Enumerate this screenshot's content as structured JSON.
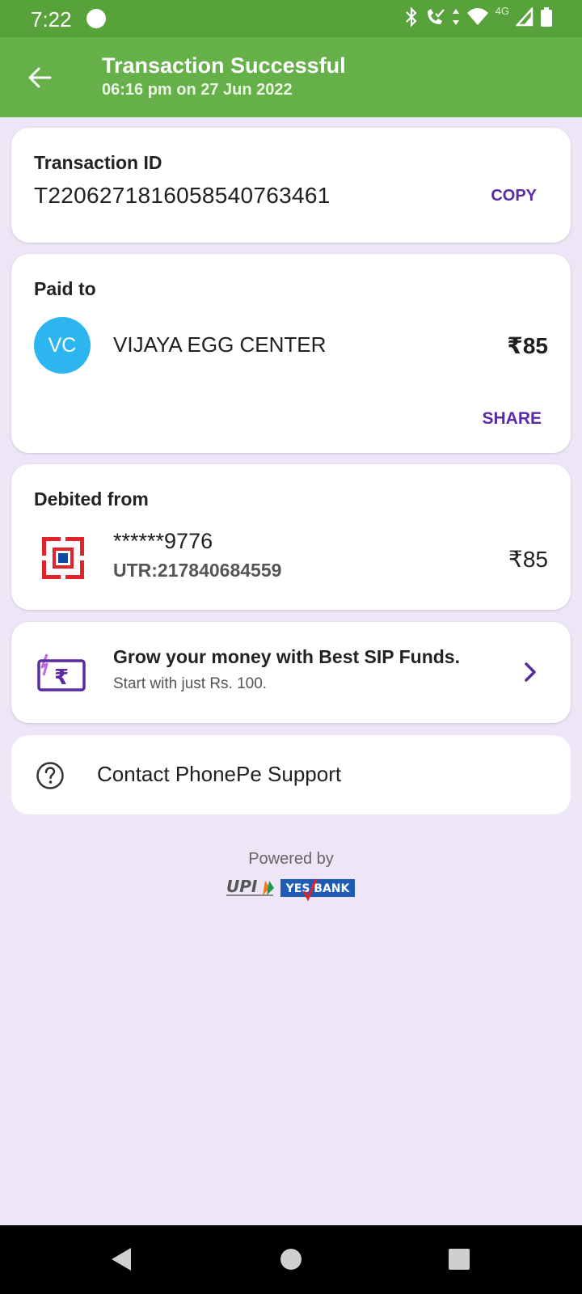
{
  "status_bar": {
    "time": "7:22",
    "network": "4G",
    "icons": [
      "bluetooth-icon",
      "wifi-call-icon",
      "data-arrows-icon",
      "wifi-icon",
      "cell-signal-icon",
      "battery-icon"
    ]
  },
  "app_bar": {
    "title": "Transaction Successful",
    "subtitle": "06:16 pm on 27 Jun 2022",
    "back_icon": "arrow-left-icon"
  },
  "transaction": {
    "label": "Transaction ID",
    "id": "T2206271816058540763461",
    "copy_label": "COPY"
  },
  "paid_to": {
    "label": "Paid to",
    "initials": "VC",
    "name": "VIJAYA EGG CENTER",
    "amount": "₹85",
    "share_label": "SHARE"
  },
  "debited_from": {
    "label": "Debited from",
    "account": "******9776",
    "utr": "UTR:217840684559",
    "amount": "₹85",
    "bank_icon": "hdfc-bank-logo"
  },
  "promo": {
    "heading": "Grow your money with Best SIP Funds.",
    "subtext": "Start with just Rs. 100.",
    "icon": "rupee-card-icon"
  },
  "support": {
    "label": "Contact PhonePe Support",
    "icon": "help-circle-icon"
  },
  "footer": {
    "powered_by": "Powered by",
    "logo_upi": "UPI",
    "logo_bank": "YES BANK"
  },
  "colors": {
    "status_bar": "#57a23a",
    "app_bar": "#66b049",
    "background": "#ede6f6",
    "accent_purple": "#5a2aa5",
    "avatar": "#2db5f0",
    "hdfc_red": "#e3222b",
    "hdfc_blue": "#0c4da2"
  }
}
